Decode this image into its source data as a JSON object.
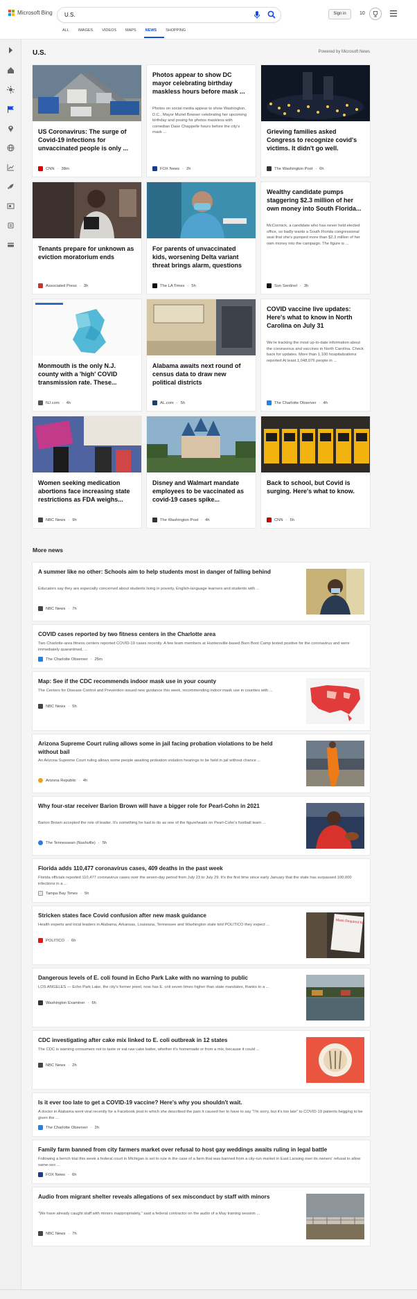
{
  "header": {
    "brand": "Microsoft Bing",
    "search_value": "U.S.",
    "signin": "Sign in",
    "rewards_count": "10"
  },
  "tabs": [
    "ALL",
    "IMAGES",
    "VIDEOS",
    "MAPS",
    "NEWS",
    "SHOPPING"
  ],
  "section": {
    "title": "U.S.",
    "powered": "Powered by Microsoft News"
  },
  "cards": [
    {
      "title": "US Coronavirus: The surge of Covid-19 infections for unvaccinated people is only ...",
      "source": "CNN",
      "time": "38m",
      "badge": "#cc0000"
    },
    {
      "title": "Photos appear to show DC mayor celebrating birthday maskless hours before mask ...",
      "summary": "Photos on social media appear to show Washington, D.C., Mayor Muriel Bowser celebrating her upcoming birthday and posing for photos maskless with comedian Dave Chappelle hours before the city's mask ...",
      "source": "FOX News",
      "time": "2h",
      "badge": "#1b3a8c"
    },
    {
      "title": "Grieving families asked Congress to recognize covid's victims. It didn't go well.",
      "source": "The Washington Post",
      "time": "6h",
      "badge": "#333333"
    },
    {
      "title": "Tenants prepare for unknown as eviction moratorium ends",
      "source": "Associated Press",
      "time": "3h",
      "badge": "#d32f2f"
    },
    {
      "title": "For parents of unvaccinated kids, worsening Delta variant threat brings alarm, questions",
      "source": "The LA Times",
      "time": "5h",
      "badge": "#111111"
    },
    {
      "title": "Wealthy candidate pumps staggering $2.3 million of her own money into South Florida...",
      "summary": "McCormick, a candidate who has never held elected office, so badly wants a South Florida congressional seat that she's pumped more than $2.3 million of her own money into the campaign. The figure is ...",
      "source": "Sun Sentinel",
      "time": "3h",
      "badge": "#111111"
    },
    {
      "title": "Monmouth is the only N.J. county with a 'high' COVID transmission rate. These...",
      "source": "NJ.com",
      "time": "4h",
      "badge": "#555555"
    },
    {
      "title": "Alabama awaits next round of census data to draw new political districts",
      "source": "AL.com",
      "time": "5h",
      "badge": "#1e3d6b"
    },
    {
      "title": "COVID vaccine live updates: Here's what to know in North Carolina on July 31",
      "summary": "We're tracking the most up-to-date information about the coronavirus and vaccines in North Carolina. Check back for updates. More than 1,100 hospitalizations reported At least 1,048,076 people in ...",
      "source": "The Charlotte Observer",
      "time": "4h",
      "badge": "#2a7de1"
    },
    {
      "title": "Women seeking medication abortions face increasing state restrictions as FDA weighs...",
      "source": "NBC News",
      "time": "9h",
      "badge": "#444444"
    },
    {
      "title": "Disney and Walmart mandate employees to be vaccinated as covid-19 cases spike...",
      "source": "The Washington Post",
      "time": "4h",
      "badge": "#333333"
    },
    {
      "title": "Back to school, but Covid is surging. Here's what to know.",
      "source": "CNN",
      "time": "5h",
      "badge": "#cc0000"
    }
  ],
  "images": {
    "c0": "tent",
    "c3": "woman",
    "c4": "mask",
    "c6": "map",
    "c7": "office",
    "c9": "protest",
    "c10": "castle",
    "c11": "bus"
  },
  "more_news_title": "More news",
  "news": [
    {
      "title": "A summer like no other: Schools aim to help students most in danger of falling behind",
      "summary": "Educators say they are especially concerned about students living in poverty, English-language learners and students with ...",
      "source": "NBC News",
      "time": "7h",
      "badge": "#444444",
      "thumb": "student"
    },
    {
      "title": "COVID cases reported by two fitness centers in the Charlotte area",
      "summary": "Two Charlotte-area fitness centers reported COVID-19 cases recently. A few team members at Huntersville-based Burn Boot Camp tested positive for the coronavirus and were immediately quarantined, ...",
      "source": "The Charlotte Observer",
      "time": "25m",
      "badge": "#2a7de1"
    },
    {
      "title": "Map: See if the CDC recommends indoor mask use in your county",
      "summary": "The Centers for Disease Control and Prevention issued new guidance this week, recommending indoor mask use in counties with ...",
      "source": "NBC News",
      "time": "5h",
      "badge": "#444444",
      "thumb": "usmap"
    },
    {
      "title": "Arizona Supreme Court ruling allows some in jail facing probation violations to be held without bail",
      "summary": "An Arizona Supreme Court ruling allows some people awaiting probation violation hearings to be held in jail without chance ...",
      "source": "Arizona Republic",
      "time": "4h",
      "badge": "#f0a020",
      "thumb": "jail"
    },
    {
      "title": "Why four-star receiver Barion Brown will have a bigger role for Pearl-Cohn in 2021",
      "summary": "Barion Brown accepted the role of leader. It's something he had to do as one of the figureheads on Pearl-Cohn's football team ...",
      "source": "The Tennessean (Nashville)",
      "time": "5h",
      "badge": "#2a7de1",
      "thumb": "football"
    },
    {
      "title": "Florida adds 110,477 coronavirus cases, 409 deaths in the past week",
      "summary": "Florida officials reported 110,477 coronavirus cases over the seven-day period from July 23 to July 29. It's the first time since early January that the state has surpassed 100,000 infections in a ...",
      "source": "Tampa Bay Times",
      "time": "5h",
      "badge": "#e8e8e8"
    },
    {
      "title": "Stricken states face Covid confusion after new mask guidance",
      "summary": "Health experts and local leaders in Alabama, Arkansas, Louisiana, Tennessee and Washington state told POLITICO they expect ...",
      "source": "POLITICO",
      "time": "6h",
      "badge": "#d71920",
      "thumb": "sign",
      "sign_text": "Mask Required for Entry"
    },
    {
      "title": "Dangerous levels of E. coli found in Echo Park Lake with no warning to public",
      "summary": "LOS ANGELES — Echo Park Lake, the city's former jewel, now has E. coli seven times higher than state mandates, thanks to a ...",
      "source": "Washington Examiner",
      "time": "6h",
      "badge": "#333333",
      "thumb": "lake"
    },
    {
      "title": "CDC investigating after cake mix linked to E. coli outbreak in 12 states",
      "summary": "The CDC is warning consumers not to taste or eat raw cake batter, whether it's homemade or from a mix, because it could ...",
      "source": "NBC News",
      "time": "2h",
      "badge": "#444444",
      "thumb": "cake"
    },
    {
      "title": "Is it ever too late to get a COVID-19 vaccine? Here's why you shouldn't wait.",
      "summary": "A doctor in Alabama went viral recently for a Facebook post in which she described the pain it caused her to have to say \"I'm sorry, but it's too late\" to COVID-19 patients begging to be given the ...",
      "source": "The Charlotte Observer",
      "time": "2h",
      "badge": "#2a7de1"
    },
    {
      "title": "Family farm banned from city farmers market over refusal to host gay weddings awaits ruling in legal battle",
      "summary": "Following a bench trial this week a federal court in Michigan is set to rule in the case of a farm that was banned from a city-run market in East Lansing over its owners' refusal to allow same-sex ...",
      "source": "FOX News",
      "time": "6h",
      "badge": "#1b3a8c"
    },
    {
      "title": "Audio from migrant shelter reveals allegations of sex misconduct by staff with minors",
      "summary": "\"We have already caught staff with minors inappropriately,\" said a federal contractor on the audio of a May training session ...",
      "source": "NBC News",
      "time": "7h",
      "badge": "#444444",
      "thumb": "shelter"
    }
  ],
  "colors": {
    "accent": "#174ae4",
    "bg": "#f5f5f5",
    "card": "#ffffff"
  }
}
